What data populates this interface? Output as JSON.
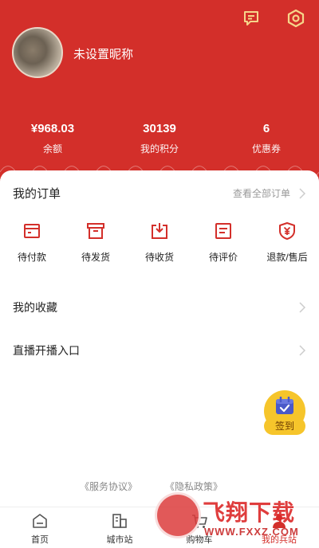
{
  "profile": {
    "nickname": "未设置昵称"
  },
  "stats": [
    {
      "value": "¥968.03",
      "label": "余额"
    },
    {
      "value": "30139",
      "label": "我的积分"
    },
    {
      "value": "6",
      "label": "优惠券"
    }
  ],
  "orders": {
    "title": "我的订单",
    "view_all": "查看全部订单",
    "items": [
      {
        "label": "待付款",
        "icon": "wallet-icon"
      },
      {
        "label": "待发货",
        "icon": "box-icon"
      },
      {
        "label": "待收货",
        "icon": "receive-icon"
      },
      {
        "label": "待评价",
        "icon": "review-icon"
      },
      {
        "label": "退款/售后",
        "icon": "refund-shield-icon"
      }
    ]
  },
  "rows": [
    {
      "label": "我的收藏"
    },
    {
      "label": "直播开播入口"
    }
  ],
  "checkin": {
    "label": "签到"
  },
  "footer_links": [
    "《服务协议》",
    "《隐私政策》"
  ],
  "tabs": [
    {
      "label": "首页",
      "icon": "home-icon"
    },
    {
      "label": "城市站",
      "icon": "city-icon"
    },
    {
      "label": "购物车",
      "icon": "cart-icon"
    },
    {
      "label": "我的兵站",
      "icon": "user-icon"
    }
  ],
  "watermark": {
    "text": "飞翔下载",
    "url": "WWW.FXXZ.COM"
  },
  "colors": {
    "brand": "#d32f2a",
    "checkin": "#f6c52b",
    "muted": "#999999"
  }
}
